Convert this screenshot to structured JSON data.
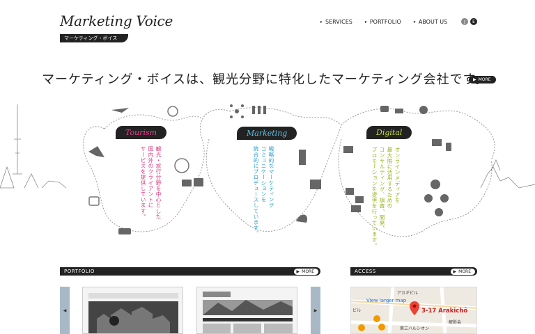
{
  "header": {
    "logo": "Marketing Voice",
    "logo_sub": "マーケティング・ボイス",
    "nav": [
      {
        "label": "SERVICES"
      },
      {
        "label": "PORTFOLIO"
      },
      {
        "label": "ABOUT US"
      }
    ],
    "lang": [
      {
        "label": "J"
      },
      {
        "label": "E"
      }
    ]
  },
  "hero": {
    "headline": "マーケティング・ボイスは、観光分野に特化したマーケティング会社です。",
    "more_label": "MORE"
  },
  "categories": {
    "tourism": {
      "title": "Tourism",
      "color": "#e8408f",
      "text": "観光・旅行分野を中心とした\n国内外のクライアントに\nサービスを提供しています。"
    },
    "marketing": {
      "title": "Marketing",
      "color": "#5cc4ea",
      "text": "戦略的なマーケティング\nコミュニケーションを\n統合的にプロデュースしています。"
    },
    "digital": {
      "title": "Digital",
      "color": "#c6de34",
      "text": "オンラインメディアを\n最大限に活用するための\nコンサルティング、調査、開発、\nプロモーションを提供を行っています。"
    }
  },
  "portfolio": {
    "title": "PORTFOLIO",
    "more_label": "MORE",
    "prev": "◀",
    "next": "▶"
  },
  "access": {
    "title": "ACCESS",
    "more_label": "MORE",
    "map_link": "View larger map",
    "place": "3-17 Arakichō",
    "labels": [
      "アカギビル",
      "解影会",
      "第三ハルシオン",
      "ビル"
    ]
  }
}
